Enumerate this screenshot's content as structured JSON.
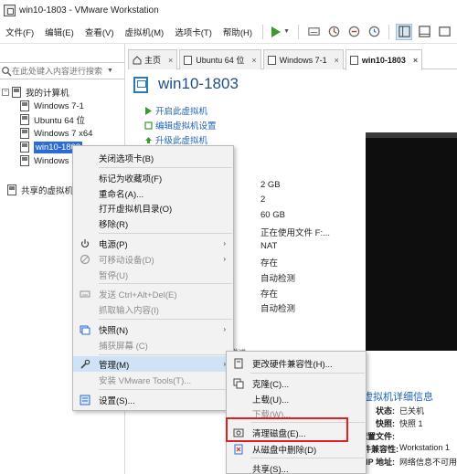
{
  "window": {
    "title": "win10-1803 - VMware Workstation"
  },
  "menubar": {
    "items": [
      "文件(F)",
      "编辑(E)",
      "查看(V)",
      "虚拟机(M)",
      "选项卡(T)",
      "帮助(H)"
    ]
  },
  "library": {
    "search_placeholder": "在此处键入内容进行搜索",
    "root_label": "我的计算机",
    "vms": [
      "Windows 7-1",
      "Ubuntu 64 位",
      "Windows 7 x64",
      "win10-1803",
      "Windows"
    ],
    "shared_label": "共享的虚拟机"
  },
  "tabs": [
    {
      "label": "主页"
    },
    {
      "label": "Ubuntu 64 位"
    },
    {
      "label": "Windows 7-1"
    },
    {
      "label": "win10-1803"
    }
  ],
  "main": {
    "vm_title": "win10-1803",
    "actions": [
      "开启此虚拟机",
      "编辑虚拟机设置",
      "升级此虚拟机"
    ],
    "hardware_values": [
      "2 GB",
      "2",
      "60 GB",
      "正在使用文件 F:...",
      "NAT",
      "存在",
      "自动检测",
      "存在",
      "自动检测"
    ],
    "section_fragment": "描述",
    "details_heading": "虚拟机详细信息",
    "details": [
      {
        "label": "状态:",
        "value": "已关机"
      },
      {
        "label": "快照:",
        "value": "快照 1"
      },
      {
        "label": "配置文件:",
        "value": ""
      },
      {
        "label": "硬件兼容性:",
        "value": "Workstation 1"
      },
      {
        "label": "IP 地址:",
        "value": "网络信息不可用"
      }
    ]
  },
  "context_menu": {
    "items": [
      {
        "label": "关闭选项卡(B)"
      },
      {
        "label": "标记为收藏项(F)"
      },
      {
        "label": "重命名(A)..."
      },
      {
        "label": "打开虚拟机目录(O)"
      },
      {
        "label": "移除(R)"
      },
      {
        "label": "电源(P)"
      },
      {
        "label": "可移动设备(D)"
      },
      {
        "label": "暂停(U)"
      },
      {
        "label": "发送 Ctrl+Alt+Del(E)"
      },
      {
        "label": "抓取输入内容(I)"
      },
      {
        "label": "快照(N)"
      },
      {
        "label": "捕获屏幕 (C)"
      },
      {
        "label": "管理(M)"
      },
      {
        "label": "安装 VMware Tools(T)..."
      },
      {
        "label": "设置(S)..."
      }
    ]
  },
  "submenu": {
    "items": [
      {
        "label": "更改硬件兼容性(H)..."
      },
      {
        "label": "克隆(C)..."
      },
      {
        "label": "上载(U)..."
      },
      {
        "label": "下载(W)..."
      },
      {
        "label": "清理磁盘(E)..."
      },
      {
        "label": "从磁盘中删除(D)"
      },
      {
        "label": "共享(S)..."
      }
    ]
  },
  "colors": {
    "accent": "#2d6bd6",
    "link": "#1e63b5",
    "play": "#3a9a2e",
    "highlight_box": "#e02020"
  }
}
